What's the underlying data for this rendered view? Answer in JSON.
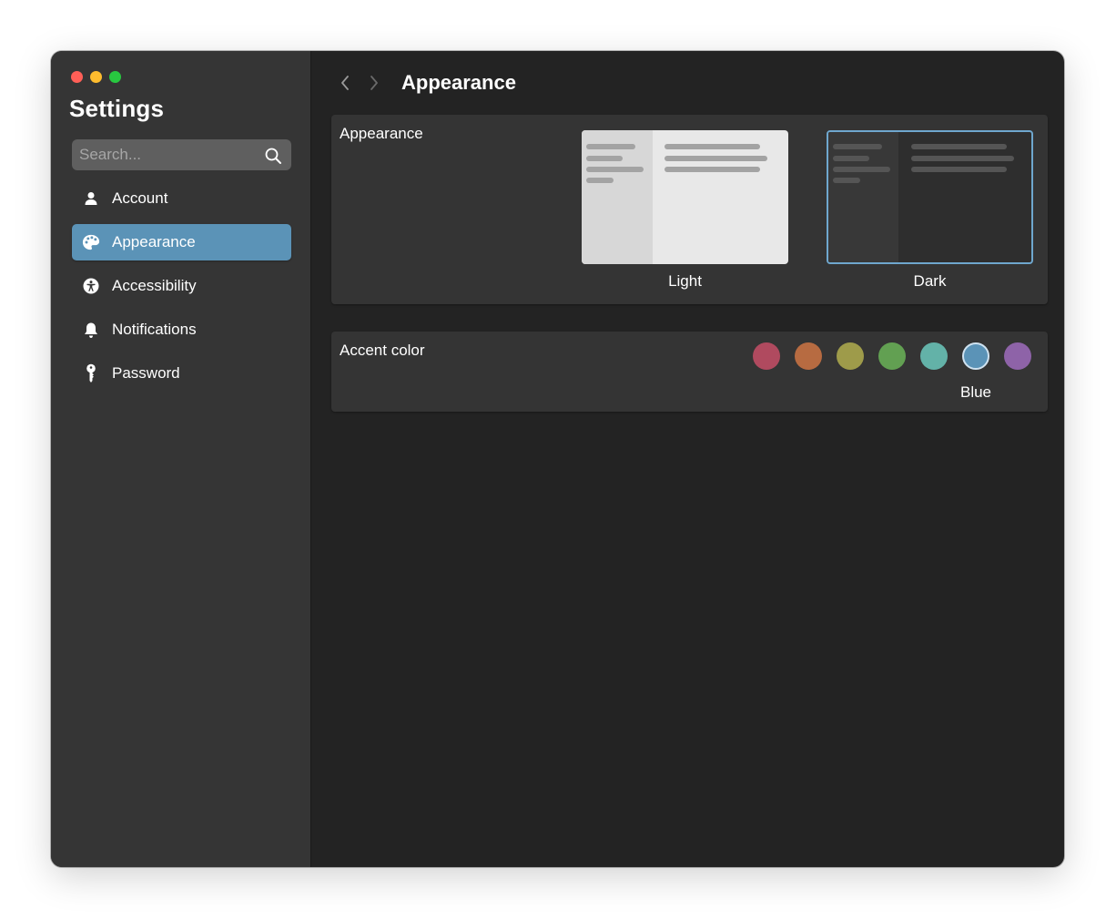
{
  "sidebar": {
    "title": "Settings",
    "search": {
      "placeholder": "Search...",
      "value": ""
    },
    "items": [
      {
        "label": "Account",
        "icon": "person-icon",
        "active": false
      },
      {
        "label": "Appearance",
        "icon": "palette-icon",
        "active": true
      },
      {
        "label": "Accessibility",
        "icon": "accessibility-icon",
        "active": false
      },
      {
        "label": "Notifications",
        "icon": "bell-icon",
        "active": false
      },
      {
        "label": "Password",
        "icon": "key-icon",
        "active": false
      }
    ]
  },
  "header": {
    "title": "Appearance",
    "back_icon": "chevron-left-icon",
    "forward_icon": "chevron-right-icon"
  },
  "appearance_card": {
    "label": "Appearance",
    "options": [
      {
        "label": "Light",
        "selected": false
      },
      {
        "label": "Dark",
        "selected": true
      }
    ]
  },
  "accent_card": {
    "label": "Accent color",
    "selected_label": "Blue",
    "colors": [
      {
        "name": "Red",
        "hex": "#b04a5f"
      },
      {
        "name": "Orange",
        "hex": "#b76b41"
      },
      {
        "name": "Yellow",
        "hex": "#9e9b4a"
      },
      {
        "name": "Green",
        "hex": "#62a052"
      },
      {
        "name": "Teal",
        "hex": "#63b2a8"
      },
      {
        "name": "Blue",
        "hex": "#5b93b7",
        "selected": true
      },
      {
        "name": "Purple",
        "hex": "#8e63a8"
      }
    ]
  },
  "colors": {
    "accent": "#5b93b7",
    "sidebar_bg": "#353535",
    "content_bg": "#232323",
    "card_bg": "#343434"
  }
}
